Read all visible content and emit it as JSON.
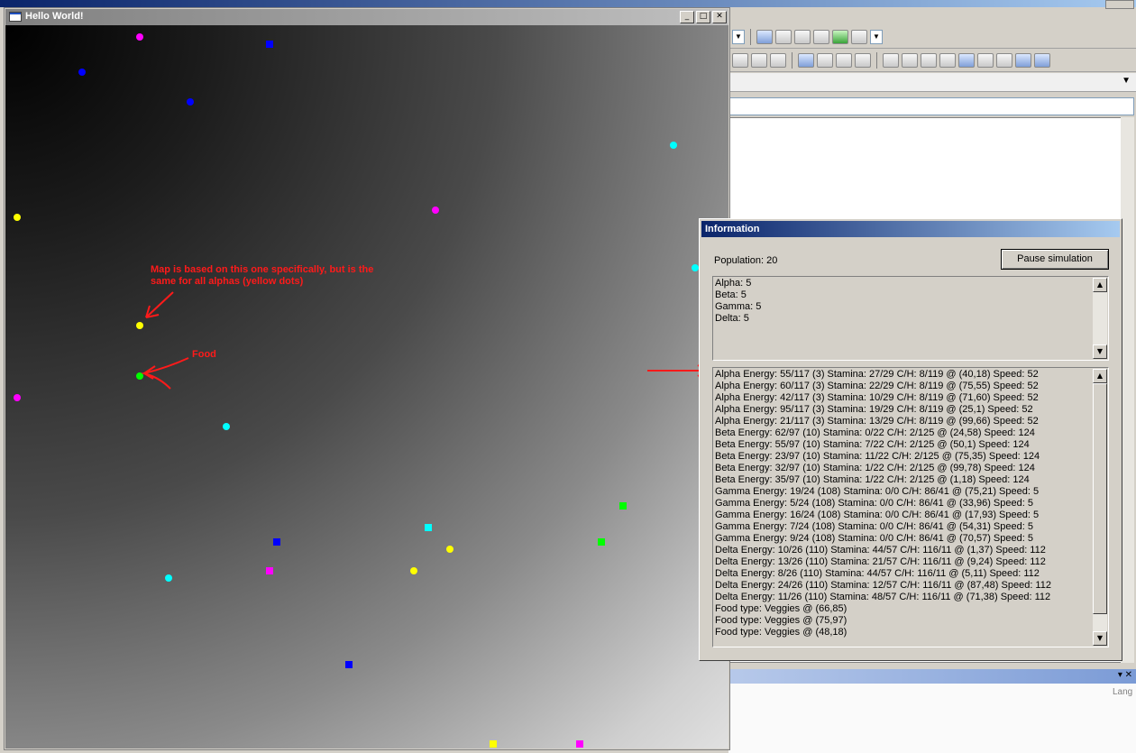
{
  "window": {
    "title": "Hello World!"
  },
  "caption_buttons": {
    "minimize": "_",
    "maximize": "□",
    "close": "✕"
  },
  "annotations": {
    "map_note_line1": "Map is based on this one specifically, but is the",
    "map_note_line2": "same for all alphas (yellow dots)",
    "food_label": "Food"
  },
  "info_dialog": {
    "title": "Information",
    "population": "Population: 20",
    "pause_button": "Pause simulation",
    "summary_lines": [
      "Alpha: 5",
      "Beta: 5",
      "Gamma: 5",
      "Delta: 5"
    ],
    "detail_lines": [
      "Alpha Energy: 55/117 (3) Stamina: 27/29 C/H: 8/119 @ (40,18) Speed: 52",
      "Alpha Energy: 60/117 (3) Stamina: 22/29 C/H: 8/119 @ (75,55) Speed: 52",
      "Alpha Energy: 42/117 (3) Stamina: 10/29 C/H: 8/119 @ (71,60) Speed: 52",
      "Alpha Energy: 95/117 (3) Stamina: 19/29 C/H: 8/119 @ (25,1) Speed: 52",
      "Alpha Energy: 21/117 (3) Stamina: 13/29 C/H: 8/119 @ (99,66) Speed: 52",
      "Beta Energy: 62/97 (10) Stamina: 0/22 C/H: 2/125 @ (24,58) Speed: 124",
      "Beta Energy: 55/97 (10) Stamina: 7/22 C/H: 2/125 @ (50,1) Speed: 124",
      "Beta Energy: 23/97 (10) Stamina: 11/22 C/H: 2/125 @ (75,35) Speed: 124",
      "Beta Energy: 32/97 (10) Stamina: 1/22 C/H: 2/125 @ (99,78) Speed: 124",
      "Beta Energy: 35/97 (10) Stamina: 1/22 C/H: 2/125 @ (1,18) Speed: 124",
      "Gamma Energy: 19/24 (108) Stamina: 0/0 C/H: 86/41 @ (75,21) Speed: 5",
      "Gamma Energy: 5/24 (108) Stamina: 0/0 C/H: 86/41 @ (33,96) Speed: 5",
      "Gamma Energy: 16/24 (108) Stamina: 0/0 C/H: 86/41 @ (17,93) Speed: 5",
      "Gamma Energy: 7/24 (108) Stamina: 0/0 C/H: 86/41 @ (54,31) Speed: 5",
      "Gamma Energy: 9/24 (108) Stamina: 0/0 C/H: 86/41 @ (70,57) Speed: 5",
      "Delta Energy: 10/26 (110) Stamina: 44/57 C/H: 116/11 @ (1,37) Speed: 112",
      "Delta Energy: 13/26 (110) Stamina: 21/57 C/H: 116/11 @ (9,24) Speed: 112",
      "Delta Energy: 8/26 (110) Stamina: 44/57 C/H: 116/11 @ (5,11) Speed: 112",
      "Delta Energy: 24/26 (110) Stamina: 12/57 C/H: 116/11 @ (87,48) Speed: 112",
      "Delta Energy: 11/26 (110) Stamina: 48/57 C/H: 116/11 @ (71,38) Speed: 112",
      "Food type: Veggies @ (66,85)",
      "Food type: Veggies @ (75,97)",
      "Food type: Veggies @ (48,18)"
    ]
  },
  "ide": {
    "lang_label": "Lang"
  },
  "colors": {
    "alpha": "#ffff00",
    "beta": "#00ffff",
    "gamma": "#ff00ff",
    "delta": "#0000ff",
    "food": "#00ff00",
    "annotation": "#ff1a1a"
  }
}
